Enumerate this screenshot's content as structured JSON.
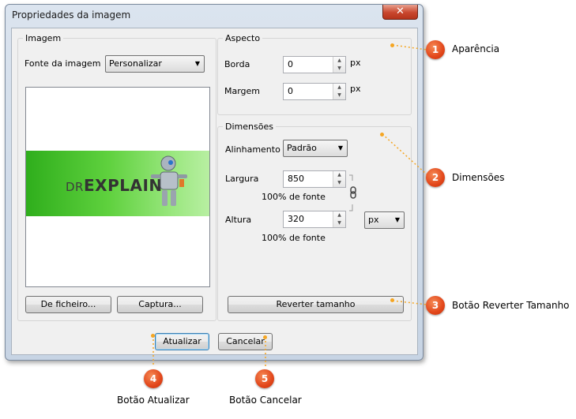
{
  "window": {
    "title": "Propriedades da imagem",
    "close_glyph": "✕"
  },
  "imagem": {
    "legend": "Imagem",
    "source_label": "Fonte da imagem",
    "source_value": "Personalizar",
    "logo_prefix": "DR",
    "logo_main": "EXPLAIN",
    "from_file_button": "De ficheiro...",
    "capture_button": "Captura..."
  },
  "aspecto": {
    "legend": "Aspecto",
    "border_label": "Borda",
    "border_value": "0",
    "border_unit": "px",
    "margin_label": "Margem",
    "margin_value": "0",
    "margin_unit": "px"
  },
  "dimensoes": {
    "legend": "Dimensões",
    "align_label": "Alinhamento",
    "align_value": "Padrão",
    "width_label": "Largura",
    "width_value": "850",
    "width_note": "100% de fonte",
    "height_label": "Altura",
    "height_value": "320",
    "height_note": "100% de fonte",
    "unit_value": "px",
    "revert_button": "Reverter tamanho"
  },
  "footer": {
    "update_button": "Atualizar",
    "cancel_button": "Cancelar"
  },
  "callouts": [
    {
      "num": "1",
      "text": "Aparência"
    },
    {
      "num": "2",
      "text": "Dimensões"
    },
    {
      "num": "3",
      "text": "Botão Reverter Tamanho"
    },
    {
      "num": "4",
      "text": "Botão Atualizar"
    },
    {
      "num": "5",
      "text": "Botão Cancelar"
    }
  ]
}
